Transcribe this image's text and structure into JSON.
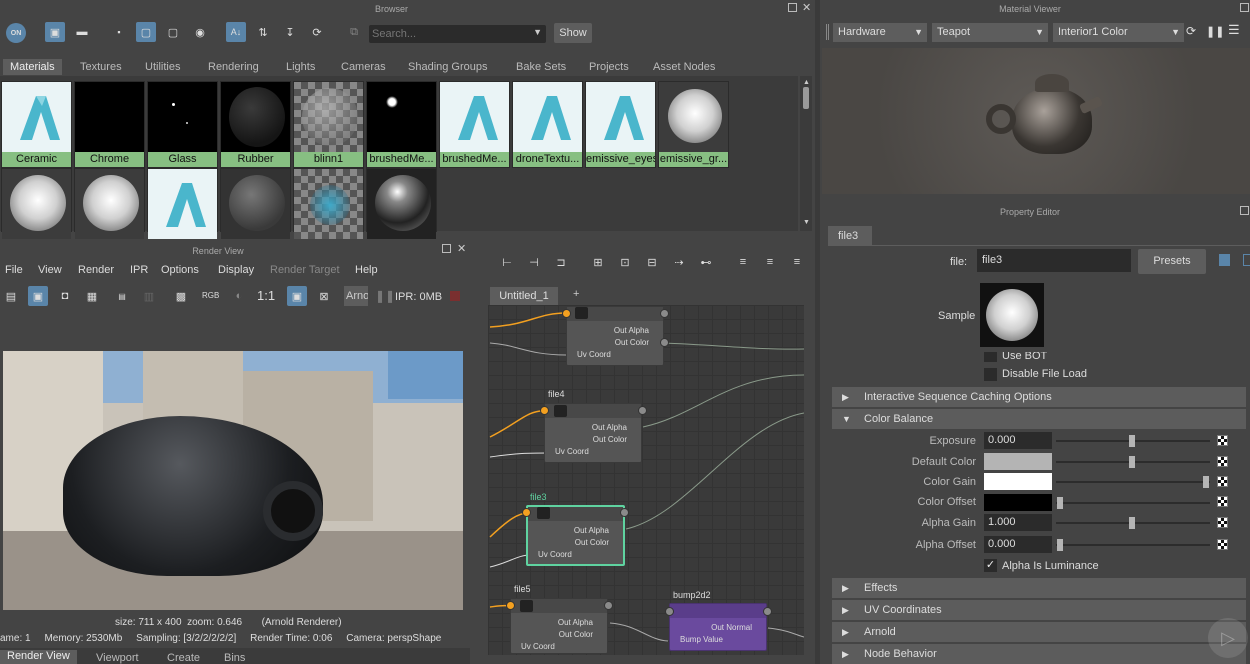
{
  "browser": {
    "title": "Browser",
    "search_placeholder": "Search...",
    "show_button": "Show",
    "tabs": [
      "Materials",
      "Textures",
      "Utilities",
      "Rendering",
      "Lights",
      "Cameras",
      "Shading Groups",
      "Bake Sets",
      "Projects",
      "Asset Nodes"
    ],
    "row1": [
      "Ceramic",
      "Chrome",
      "Glass",
      "Rubber",
      "blinn1",
      "brushedMe...",
      "brushedMe...",
      "droneTextu...",
      "emissive_eyes",
      "emissive_gr..."
    ],
    "toggle_label": "ON"
  },
  "render_view": {
    "title": "Render View",
    "menu": [
      "File",
      "View",
      "Render",
      "IPR",
      "Options",
      "Display",
      "Render Target",
      "Help"
    ],
    "ratio": "1:1",
    "rgb": "RGB",
    "renderer_chip": "Arnold",
    "ipr_status": "IPR: 0MB",
    "status_line1": "size: 711 x 400  zoom: 0.646       (Arnold Renderer)",
    "status_line2": "ame: 1     Memory: 2530Mb     Sampling: [3/2/2/2/2/2]     Render Time: 0:06     Camera: perspShape"
  },
  "bottom_tabs": [
    "Render View",
    "Viewport",
    "Create",
    "Bins"
  ],
  "node_editor": {
    "tab": "Untitled_1",
    "add_tab": "+",
    "nodes": [
      {
        "name": "",
        "rows": [
          "Out Alpha",
          "Out Color",
          "Uv Coord"
        ]
      },
      {
        "name": "file4",
        "rows": [
          "Out Alpha",
          "Out Color",
          "Uv Coord"
        ]
      },
      {
        "name": "file3",
        "rows": [
          "Out Alpha",
          "Out Color",
          "Uv Coord"
        ]
      },
      {
        "name": "file5",
        "rows": [
          "Out Alpha",
          "Out Color",
          "Uv Coord"
        ]
      },
      {
        "name": "bump2d2",
        "rows": [
          "Out Normal",
          "Bump Value"
        ]
      }
    ]
  },
  "material_viewer": {
    "title": "Material Viewer",
    "renderer": "Hardware",
    "shape": "Teapot",
    "environment": "Interior1 Color"
  },
  "property_editor": {
    "title": "Property Editor",
    "node_tab": "file3",
    "file_label": "file:",
    "file_value": "file3",
    "presets_button": "Presets",
    "sample_label": "Sample",
    "checks": [
      {
        "label": "Use BOT",
        "checked": false
      },
      {
        "label": "Disable File Load",
        "checked": false
      }
    ],
    "sections_collapsed_top": [
      "Interactive Sequence Caching Options"
    ],
    "color_balance": {
      "title": "Color Balance",
      "exposure_label": "Exposure",
      "exposure": "0.000",
      "default_color_label": "Default Color",
      "default_color": "#b4b4b4",
      "color_gain_label": "Color Gain",
      "color_gain": "#ffffff",
      "color_offset_label": "Color Offset",
      "color_offset": "#000000",
      "alpha_gain_label": "Alpha Gain",
      "alpha_gain": "1.000",
      "alpha_offset_label": "Alpha Offset",
      "alpha_offset": "0.000",
      "alpha_is_luminance_label": "Alpha Is Luminance",
      "alpha_is_luminance": true
    },
    "sections_collapsed_bottom": [
      "Effects",
      "UV Coordinates",
      "Arnold",
      "Node Behavior"
    ]
  },
  "colors": {
    "accent": "#5a85a9",
    "thumb_caption": "#87bf82",
    "selected_node": "#5fd3a0",
    "bump_node": "#6a4a9e",
    "connection_orange": "#f3a020"
  }
}
